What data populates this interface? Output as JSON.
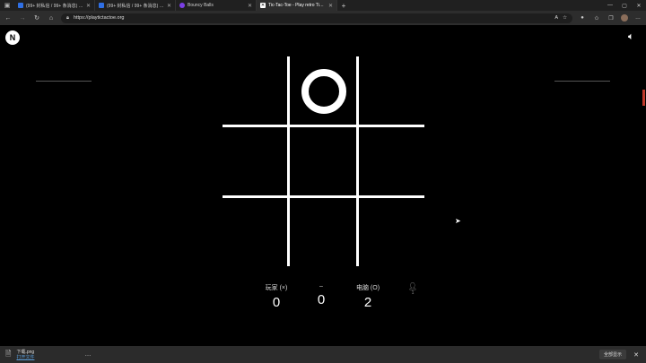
{
  "browser": {
    "tabs": [
      {
        "title": "(99+ 封私信 / 99+ 条消息) 幽灵…",
        "favicon_color": "#2f6fe4",
        "active": false
      },
      {
        "title": "(99+ 封私信 / 99+ 条消息) 有啊…",
        "favicon_color": "#2f6fe4",
        "active": false
      },
      {
        "title": "Bouncy Balls",
        "favicon_color": "#7b3fe4",
        "active": false
      },
      {
        "title": "Tic-Tac-Toe - Play retro Tic-Tac-…",
        "favicon_color": "#ffffff",
        "active": true
      }
    ],
    "new_tab_icon": "+",
    "window_controls": {
      "minimize": "—",
      "maximize": "▢",
      "close": "✕"
    },
    "url": "https://playtictactoe.org"
  },
  "game": {
    "logo_letter": "N",
    "board": [
      "",
      "O",
      "",
      "",
      "",
      "",
      "",
      "",
      ""
    ],
    "score": {
      "player_label": "玩家 (×)",
      "player_value": "0",
      "tie_label": "–",
      "tie_value": "0",
      "computer_label": "电脑 (O)",
      "computer_value": "2",
      "mode_count": "1"
    }
  },
  "downloads": {
    "file_name": "下载.png",
    "open_label": "打开文件",
    "more_label": "…",
    "show_all_label": "全部显示",
    "close_label": "✕"
  }
}
